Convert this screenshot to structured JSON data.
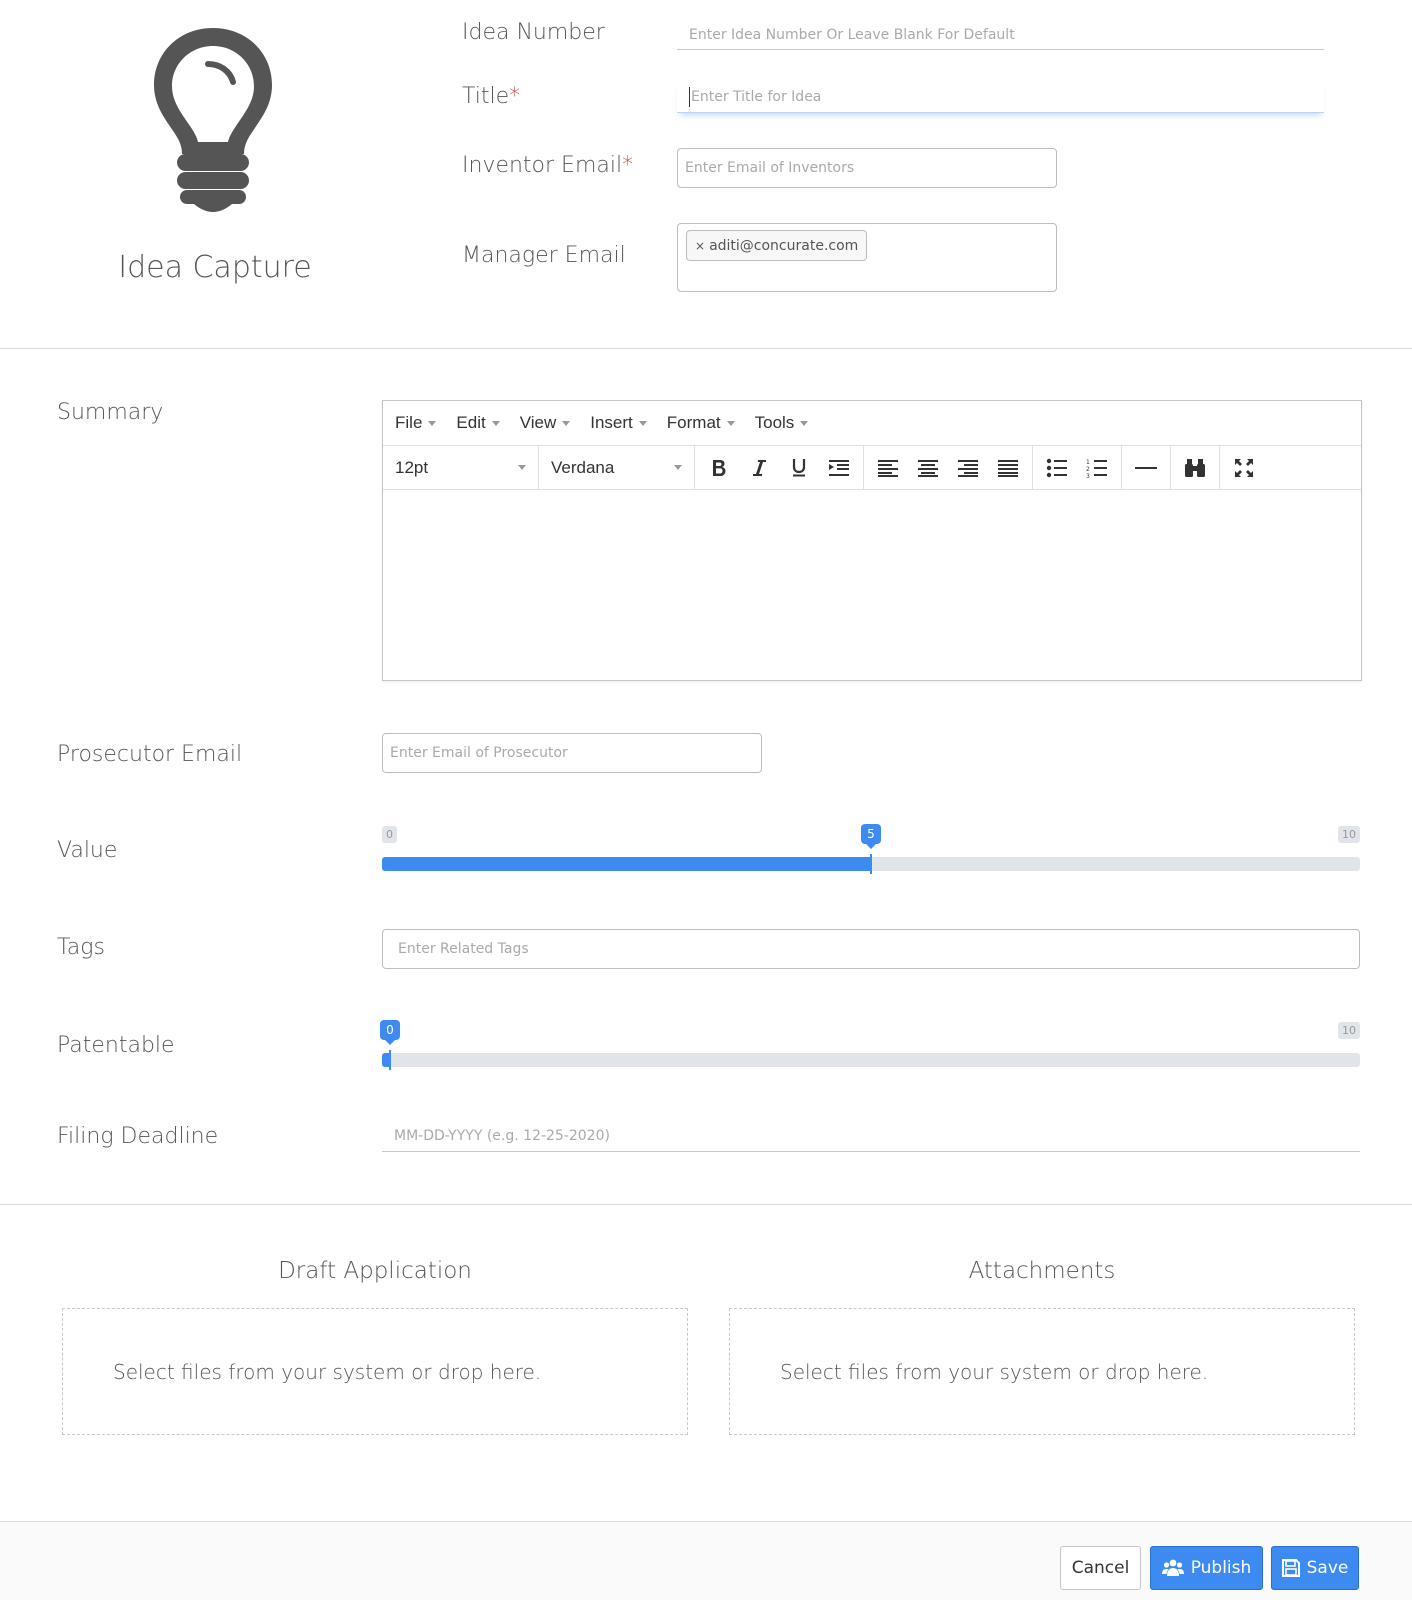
{
  "app": {
    "title": "Idea Capture"
  },
  "header_form": {
    "idea_number": {
      "label": "Idea Number",
      "placeholder": "Enter Idea Number Or Leave Blank For Default",
      "value": ""
    },
    "title": {
      "label": "Title",
      "required_mark": "*",
      "placeholder": "Enter Title for Idea",
      "value": ""
    },
    "inventor_email": {
      "label": "Inventor Email",
      "required_mark": "*",
      "placeholder": "Enter Email of Inventors",
      "value": ""
    },
    "manager_email": {
      "label": "Manager Email",
      "tags": [
        {
          "remove": "×",
          "text": "aditi@concurate.com"
        }
      ]
    }
  },
  "summary": {
    "label": "Summary",
    "menu": [
      {
        "label": "File"
      },
      {
        "label": "Edit"
      },
      {
        "label": "View"
      },
      {
        "label": "Insert"
      },
      {
        "label": "Format"
      },
      {
        "label": "Tools"
      }
    ],
    "font_size": "12pt",
    "font_family": "Verdana",
    "toolbar_icons": [
      "bold-icon",
      "italic-icon",
      "underline-icon",
      "indent-icon",
      "align-left-icon",
      "align-center-icon",
      "align-right-icon",
      "align-justify-icon",
      "bullet-list-icon",
      "numbered-list-icon",
      "horizontal-rule-icon",
      "find-binoculars-icon",
      "fullscreen-icon"
    ],
    "content": ""
  },
  "prosecutor_email": {
    "label": "Prosecutor Email",
    "placeholder": "Enter Email of Prosecutor",
    "value": ""
  },
  "value_slider": {
    "label": "Value",
    "min": 0,
    "max": 10,
    "current": 5
  },
  "tags": {
    "label": "Tags",
    "placeholder": "Enter Related Tags"
  },
  "patentable_slider": {
    "label": "Patentable",
    "min": 0,
    "max": 10,
    "current": 0
  },
  "filing_deadline": {
    "label": "Filing Deadline",
    "placeholder": "MM-DD-YYYY (e.g. 12-25-2020)"
  },
  "uploads": {
    "draft": {
      "title": "Draft Application",
      "hint": "Select files from your system or drop here."
    },
    "attachments": {
      "title": "Attachments",
      "hint": "Select files from your system or drop here."
    }
  },
  "footer": {
    "cancel_label": "Cancel",
    "publish_label": "Publish",
    "save_label": "Save"
  },
  "colors": {
    "accent": "#3d8bf0",
    "required": "#c0392b",
    "text": "#555555"
  }
}
